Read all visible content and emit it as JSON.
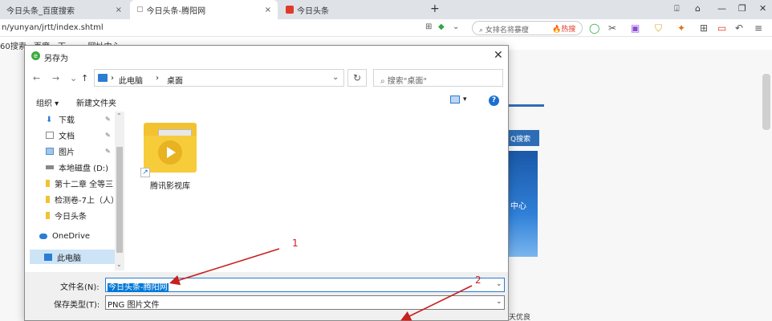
{
  "browser": {
    "tabs": [
      {
        "label": "今日头条_百度搜索",
        "close": "×"
      },
      {
        "label": "今日头条-腾阳网",
        "close": "×"
      },
      {
        "label": "今日头条",
        "close": ""
      }
    ],
    "new_tab": "+",
    "url": "n/yunyan/jrtt/index.shtml",
    "search_placeholder": "女排名将暴瘦",
    "hot_label": "热搜",
    "bookmarks": [
      "60搜索",
      "百度一下",
      "...网址中心"
    ]
  },
  "dialog": {
    "title": "另存为",
    "nav": {
      "back": "←",
      "forward": "→",
      "recent": "⌄",
      "up": "↑"
    },
    "path": {
      "root": "此电脑",
      "sep": "›",
      "current": "桌面"
    },
    "search_placeholder": "搜索\"桌面\"",
    "toolbar": {
      "organize": "组织 ▾",
      "new_folder": "新建文件夹",
      "help": "?"
    },
    "nav_items": [
      {
        "label": "下载",
        "icon": "download-icon",
        "pinned": true
      },
      {
        "label": "文档",
        "icon": "document-icon",
        "pinned": true
      },
      {
        "label": "图片",
        "icon": "picture-icon",
        "pinned": true
      },
      {
        "label": "本地磁盘 (D:)",
        "icon": "drive-icon",
        "pinned": false
      },
      {
        "label": "第十二章 全等三",
        "icon": "folder-icon",
        "pinned": false
      },
      {
        "label": "检测卷-7上（人）",
        "icon": "folder-icon",
        "pinned": false
      },
      {
        "label": "今日头条",
        "icon": "folder-icon",
        "pinned": false
      },
      {
        "label": "OneDrive",
        "icon": "cloud-icon",
        "pinned": false
      },
      {
        "label": "此电脑",
        "icon": "computer-icon",
        "pinned": false,
        "selected": true
      }
    ],
    "files": [
      {
        "label": "腾讯影视库",
        "icon": "video-folder-icon"
      }
    ],
    "filename_label": "文件名(N):",
    "filename_value": "今日头条-腾阳网",
    "filetype_label": "保存类型(T):",
    "filetype_value": "PNG 图片文件"
  },
  "annotations": {
    "arrow1": "1",
    "arrow2": "2"
  },
  "background": {
    "search_btn": "Q搜索",
    "banner_text": "中心",
    "footer_text": "天优良"
  },
  "colors": {
    "accent": "#0078d7",
    "annotation": "#c8201e",
    "folder": "#f7cc3b"
  }
}
